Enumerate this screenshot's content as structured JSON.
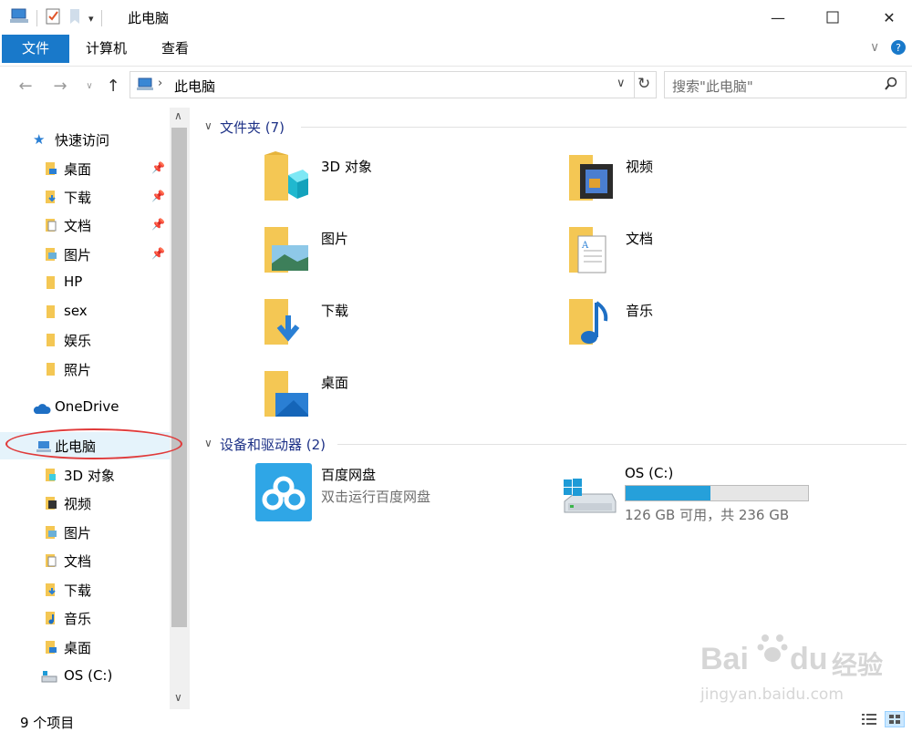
{
  "window": {
    "title": "此电脑"
  },
  "ribbon": {
    "tabs": [
      "文件",
      "计算机",
      "查看"
    ]
  },
  "address": {
    "path": "此电脑",
    "search_placeholder": "搜索\"此电脑\""
  },
  "sidebar": {
    "quick_access": "快速访问",
    "quick_items": [
      "桌面",
      "下载",
      "文档",
      "图片",
      "HP",
      "sex",
      "娱乐",
      "照片"
    ],
    "onedrive": "OneDrive",
    "this_pc": "此电脑",
    "pc_items": [
      "3D 对象",
      "视频",
      "图片",
      "文档",
      "下载",
      "音乐",
      "桌面",
      "OS (C:)"
    ]
  },
  "content": {
    "folders_header": "文件夹 (7)",
    "folders": [
      "3D 对象",
      "视频",
      "图片",
      "文档",
      "下载",
      "音乐",
      "桌面"
    ],
    "devices_header": "设备和驱动器 (2)",
    "baidu": {
      "name": "百度网盘",
      "desc": "双击运行百度网盘"
    },
    "drive": {
      "name": "OS (C:)",
      "info": "126 GB 可用，共 236 GB",
      "used_fraction": 0.466
    }
  },
  "status": {
    "count": "9 个项目"
  },
  "watermark": {
    "text1": "Bai",
    "text2": "du",
    "text3": "经验",
    "url": "jingyan.baidu.com"
  },
  "colors": {
    "accent": "#1979ca",
    "header_blue": "#1e3287",
    "folder_yellow": "#f4c754",
    "drive_bar": "#26a0da"
  }
}
